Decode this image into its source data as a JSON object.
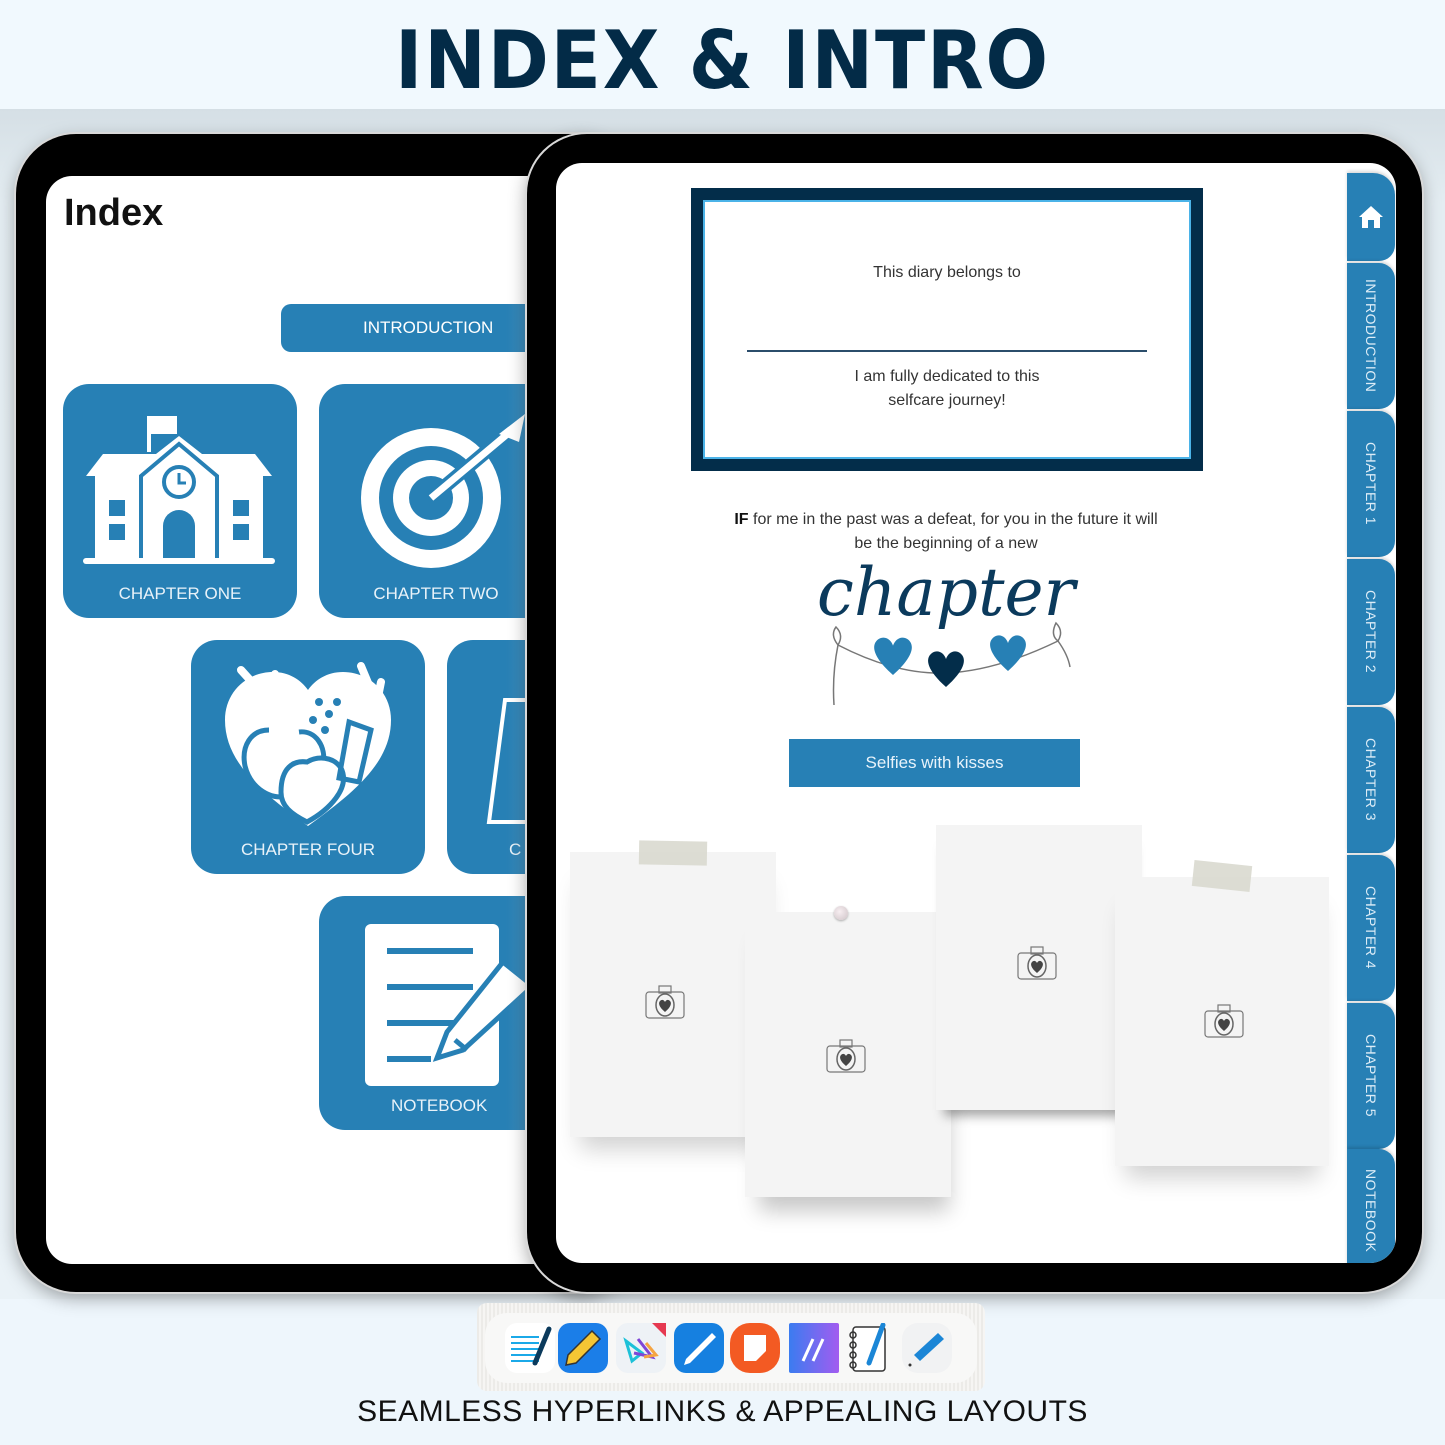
{
  "header": {
    "title": "INDEX & INTRO"
  },
  "left_tablet": {
    "title": "Index",
    "intro_button": "INTRODUCTION",
    "tiles": [
      {
        "label": "CHAPTER ONE",
        "icon": "school-icon"
      },
      {
        "label": "CHAPTER TWO",
        "icon": "target-icon"
      },
      {
        "label": "CHAPTER FOUR",
        "icon": "heart-fruit-icon"
      },
      {
        "label": "C",
        "icon": "trapezoid-icon"
      },
      {
        "label": "NOTEBOOK",
        "icon": "notebook-pen-icon"
      }
    ]
  },
  "right_tablet": {
    "owner_card": {
      "belongs": "This diary belongs to",
      "dedicated_line1": "I am fully dedicated to this",
      "dedicated_line2": "selfcare journey!"
    },
    "quote": {
      "bold": "IF",
      "line1": " for me in the past was a defeat, for you in the future it will",
      "line2": "be the beginning of a new"
    },
    "script_word": "chapter",
    "selfies_button": "Selfies with kisses",
    "side_tabs": [
      {
        "label": "home",
        "icon": "home-icon"
      },
      {
        "label": "INTRODUCTION"
      },
      {
        "label": "CHAPTER 1"
      },
      {
        "label": "CHAPTER 2"
      },
      {
        "label": "CHAPTER 3"
      },
      {
        "label": "CHAPTER 4"
      },
      {
        "label": "CHAPTER 5"
      },
      {
        "label": "NOTEBOOK"
      }
    ],
    "colors": {
      "accent": "#2780b5",
      "navy": "#032d4a",
      "light_blue": "#4bb3e8"
    }
  },
  "apps": [
    "notes-writer-icon",
    "pencil-app-icon",
    "flexcil-icon",
    "pen-app-icon",
    "samsung-notes-icon",
    "penbook-icon",
    "spiral-notebook-icon",
    "pencil-eraser-icon"
  ],
  "footer": {
    "tagline": "SEAMLESS HYPERLINKS & APPEALING LAYOUTS"
  }
}
